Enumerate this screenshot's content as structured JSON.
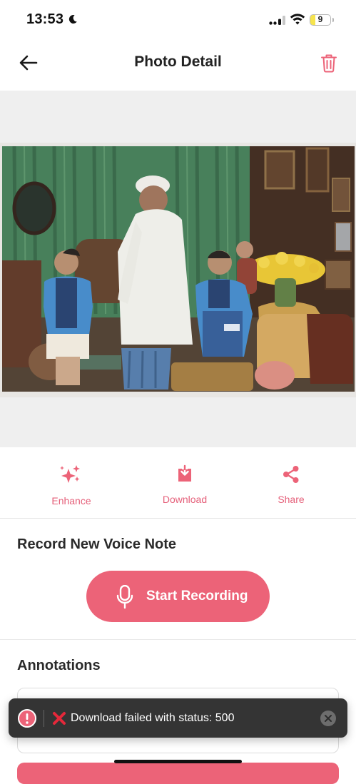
{
  "status_bar": {
    "time": "13:53",
    "battery": "9",
    "battery_level": 0.09
  },
  "header": {
    "title": "Photo Detail"
  },
  "photo": {
    "alt": "Family photo with elderly man in white and two boys in blue shirts"
  },
  "actions": {
    "enhance": "Enhance",
    "download": "Download",
    "share": "Share"
  },
  "voice_note": {
    "title": "Record New Voice Note",
    "button": "Start Recording"
  },
  "annotations": {
    "title": "Annotations"
  },
  "toast": {
    "message": "Download failed with status: 500"
  },
  "colors": {
    "accent": "#ec6378",
    "accent_text": "#e5607a",
    "toast_background": "#343434"
  }
}
